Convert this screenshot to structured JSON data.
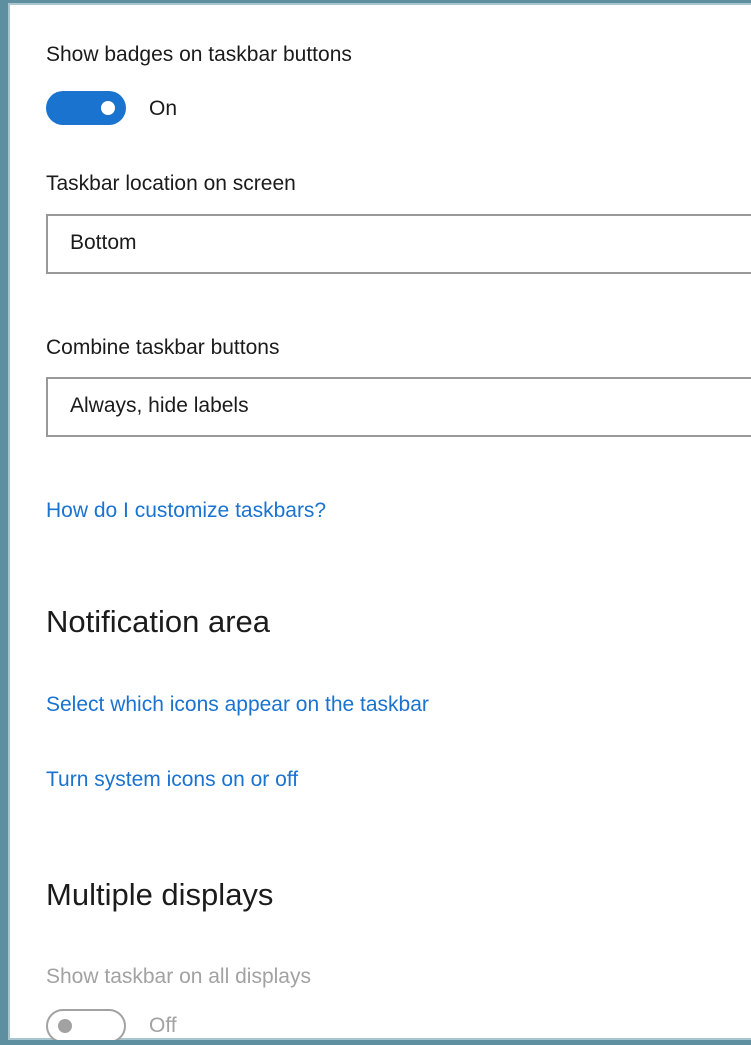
{
  "taskbar": {
    "badges_label": "Show badges on taskbar buttons",
    "badges_state": "On",
    "location_label": "Taskbar location on screen",
    "location_value": "Bottom",
    "combine_label": "Combine taskbar buttons",
    "combine_value": "Always, hide labels",
    "help_link": "How do I customize taskbars?"
  },
  "notification_area": {
    "heading": "Notification area",
    "select_icons_link": "Select which icons appear on the taskbar",
    "system_icons_link": "Turn system icons on or off"
  },
  "multiple_displays": {
    "heading": "Multiple displays",
    "show_all_label": "Show taskbar on all displays",
    "show_all_state": "Off"
  },
  "colors": {
    "accent": "#1a73cf",
    "frame": "#5d8fa0",
    "disabled": "#a2a2a2"
  }
}
